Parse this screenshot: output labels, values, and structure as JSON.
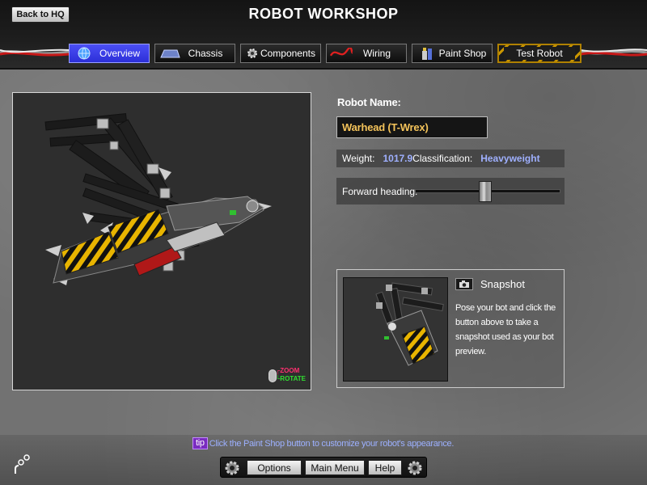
{
  "header": {
    "back_label": "Back to HQ",
    "title": "ROBOT WORKSHOP"
  },
  "tabs": [
    {
      "label": "Overview",
      "icon": "globe-icon",
      "active": true
    },
    {
      "label": "Chassis",
      "icon": "chassis-icon",
      "active": false
    },
    {
      "label": "Components",
      "icon": "gear-icon",
      "active": false
    },
    {
      "label": "Wiring",
      "icon": "wire-icon",
      "active": false
    },
    {
      "label": "Paint Shop",
      "icon": "paint-can-icon",
      "active": false
    },
    {
      "label": "Test Robot",
      "icon": "",
      "active": false
    }
  ],
  "viewport": {
    "legend_zoom": "ZOOM",
    "legend_rotate": "ROTATE"
  },
  "robot": {
    "name_label": "Robot Name:",
    "name_value": "Warhead (T-Wrex)",
    "weight_label": "Weight:",
    "weight_value": "1017.9",
    "class_label": "Classification:",
    "class_value": "Heavyweight",
    "heading_label": "Forward heading:",
    "heading_level": 0.48
  },
  "snapshot": {
    "title": "Snapshot",
    "description": "Pose your bot and click the button above to take a snapshot used as your bot preview."
  },
  "tip": {
    "badge": "tip",
    "text": "Click the Paint Shop button to customize your robot's appearance."
  },
  "bottom_menu": {
    "options": "Options",
    "main_menu": "Main Menu",
    "help": "Help"
  },
  "colors": {
    "accent_tab": "#3a3de8",
    "name_text": "#f4c35a",
    "value_text": "#9fb0ff",
    "tip_badge": "#7a2bc0"
  }
}
